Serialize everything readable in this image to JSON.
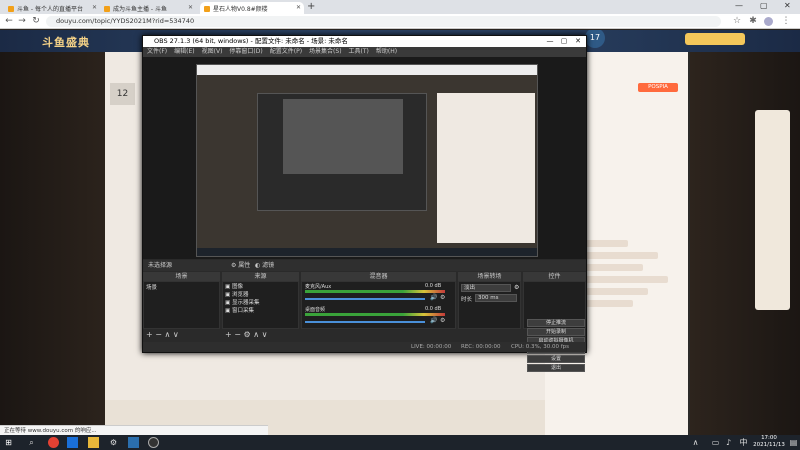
{
  "browser": {
    "tabs": [
      {
        "label": "斗鱼 - 每个人的直播平台",
        "color": "#f2a019"
      },
      {
        "label": "成为斗鱼主播 - 斗鱼",
        "color": "#f2a019"
      },
      {
        "label": "星石人物V0.8#颜楼",
        "color": "#f2a019"
      }
    ],
    "new_tab": "+",
    "url": "douyu.com/topic/YYDS2021M?rid=534740",
    "download_status": "正在等待 www.douyu.com 的响应..."
  },
  "obs": {
    "title": "OBS 27.1.3 (64 bit, windows) - 配置文件: 未命名 - 场景: 未命名",
    "menu": [
      "文件(F)",
      "编辑(E)",
      "视图(V)",
      "停靠窗口(D)",
      "配置文件(P)",
      "场景集合(S)",
      "工具(T)",
      "帮助(H)"
    ],
    "source_bar": {
      "label": "未选择源",
      "props": "属性",
      "filters": "滤镜"
    },
    "panels": {
      "scenes": {
        "title": "场景",
        "items": [
          "场景"
        ]
      },
      "sources": {
        "title": "来源",
        "items": [
          "图像",
          "浏览器",
          "显示器采集",
          "窗口采集"
        ]
      },
      "mixer": {
        "title": "混音器",
        "tracks": [
          {
            "name": "桌面音频",
            "db": "0.0 dB"
          },
          {
            "name": "麦克风/Aux",
            "db": "0.0 dB"
          }
        ]
      },
      "transitions": {
        "title": "场景转场",
        "type": "淡出",
        "duration_label": "时长",
        "duration": "300 ms"
      },
      "controls": {
        "title": "控件",
        "buttons": [
          "停止推流",
          "开始录制",
          "启动虚拟摄像机",
          "工作室模式",
          "设置",
          "退出"
        ]
      }
    },
    "status": {
      "live": "LIVE: 00:00:00",
      "rec": "REC: 00:00:00",
      "cpu": "CPU: 0.3%, 30.00 fps"
    }
  },
  "page": {
    "logo": "斗鱼盛典",
    "room_number": "12",
    "follow_badge": "POSPIA"
  },
  "taskbar": {
    "time": "17:00",
    "date": "2021/11/13",
    "lang": "中"
  }
}
